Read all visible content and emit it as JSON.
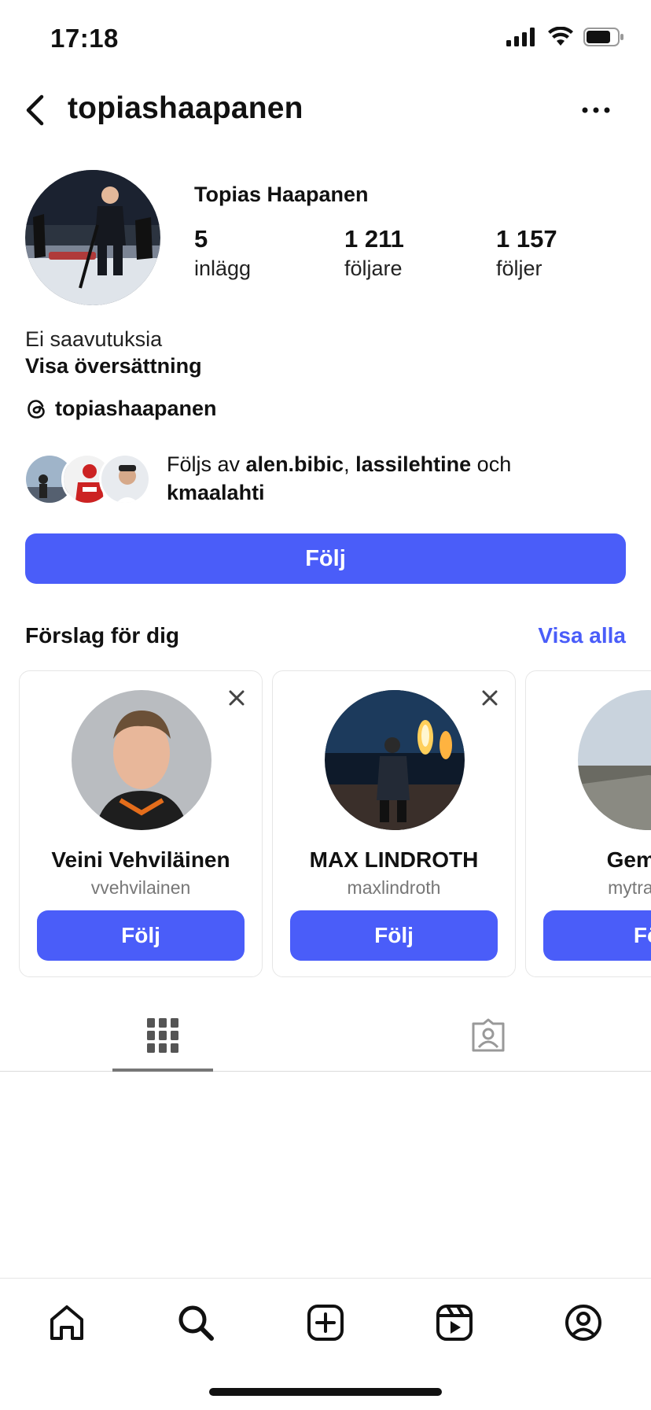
{
  "status_bar": {
    "time": "17:18"
  },
  "header": {
    "username": "topiashaapanen"
  },
  "profile": {
    "full_name": "Topias Haapanen",
    "stats": [
      {
        "value": "5",
        "label": "inlägg"
      },
      {
        "value": "1 211",
        "label": "följare"
      },
      {
        "value": "1 157",
        "label": "följer"
      }
    ],
    "bio": "Ei saavutuksia",
    "translate_label": "Visa översättning",
    "threads_handle": "topiashaapanen",
    "followed_by": {
      "prefix": "Följs av ",
      "user1": "alen.bibic",
      "sep": ", ",
      "user2": "lassilehtine",
      "conj": " och ",
      "user3": "kmaalahti"
    },
    "follow_label": "Följ"
  },
  "suggestions": {
    "title": "Förslag för dig",
    "see_all": "Visa alla",
    "cards": [
      {
        "name": "Veini Vehviläinen",
        "username": "vvehvilainen",
        "follow_label": "Följ"
      },
      {
        "name": "MAX LINDROTH",
        "username": "maxlindroth",
        "follow_label": "Följ"
      },
      {
        "name": "Gemma",
        "username": "mytravelb",
        "follow_label": "Fö"
      }
    ]
  },
  "colors": {
    "accent": "#4a5df9",
    "text": "#111111",
    "muted": "#777777"
  },
  "icons": {
    "tabs": [
      "grid-icon",
      "tagged-icon"
    ],
    "nav": [
      "home-icon",
      "search-icon",
      "create-icon",
      "reels-icon",
      "profile-icon"
    ]
  }
}
